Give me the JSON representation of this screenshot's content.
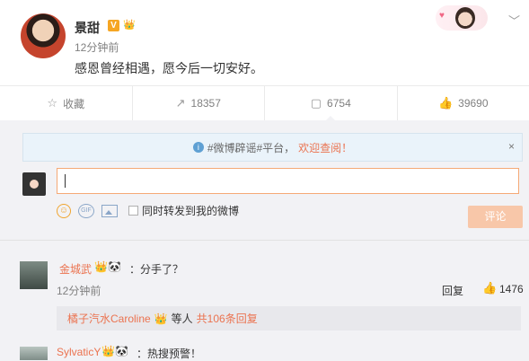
{
  "post": {
    "username": "景甜",
    "verified_badge": "V",
    "crown": "👑",
    "time": "12分钟前",
    "text": "感恩曾经相遇，愿今后一切安好。",
    "menu_icon": "chevron-down"
  },
  "actions": [
    {
      "icon": "star-icon",
      "glyph": "☆",
      "label": "收藏"
    },
    {
      "icon": "share-icon",
      "glyph": "↗",
      "label": "18357"
    },
    {
      "icon": "comment-icon",
      "glyph": "▢",
      "label": "6754"
    },
    {
      "icon": "like-icon",
      "glyph": "👍",
      "label": "39690"
    }
  ],
  "notice": {
    "icon": "info-icon",
    "prefix": "#微博辟谣#平台，",
    "link": "欢迎查阅！",
    "close": "×"
  },
  "composer": {
    "repost_label": "同时转发到我的微博",
    "submit_label": "评论",
    "gif_label": "GIF"
  },
  "comments": [
    {
      "username": "金城武",
      "emoji": "👑🐼",
      "text": "：分手了？",
      "time": "12分钟前",
      "reply_label": "回复",
      "likes": "1476",
      "sub_replies": {
        "user": "橘子汽水Caroline",
        "emoji": "👑",
        "mid": "等人",
        "count": "共106条回复"
      }
    },
    {
      "username": "SylvaticY",
      "emoji": "👑🐼",
      "text": "：热搜预警！"
    }
  ],
  "colors": {
    "accent": "#eb7350",
    "submit_bg": "#f8c7a9",
    "notice_bg": "#eaf3fa"
  }
}
